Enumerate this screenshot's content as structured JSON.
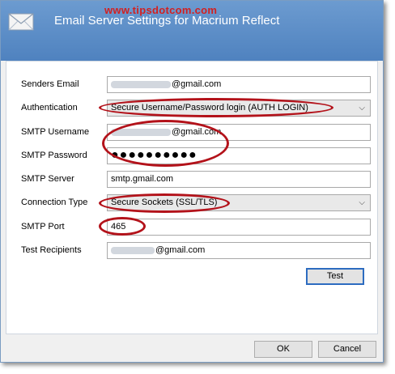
{
  "window": {
    "title": "Email Server Settings for Macrium Reflect",
    "watermark": "www.tipsdotcom.com",
    "icon": "envelope-icon"
  },
  "form": {
    "senders_email": {
      "label": "Senders Email",
      "value": "@gmail.com"
    },
    "authentication": {
      "label": "Authentication",
      "value": "Secure Username/Password login (AUTH LOGIN)"
    },
    "smtp_username": {
      "label": "SMTP Username",
      "value": "@gmail.com"
    },
    "smtp_password": {
      "label": "SMTP Password",
      "value": "●●●●●●●●●●"
    },
    "smtp_server": {
      "label": "SMTP Server",
      "value": "smtp.gmail.com"
    },
    "connection_type": {
      "label": "Connection Type",
      "value": "Secure Sockets (SSL/TLS)"
    },
    "smtp_port": {
      "label": "SMTP Port",
      "value": "465"
    },
    "test_recipients": {
      "label": "Test Recipients",
      "value": "@gmail.com"
    }
  },
  "buttons": {
    "test": "Test",
    "ok": "OK",
    "cancel": "Cancel"
  },
  "colors": {
    "highlight_ring": "#b3121a",
    "titlebar": "#5a8cc8",
    "watermark": "#d22020"
  }
}
